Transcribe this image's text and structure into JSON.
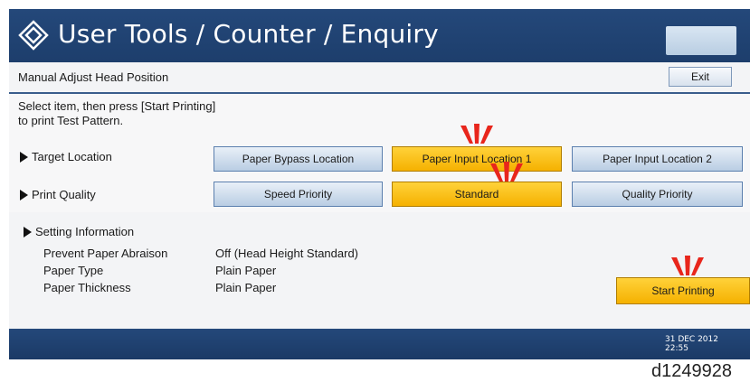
{
  "header": {
    "title": "User Tools / Counter / Enquiry",
    "logo_icon": "diamond-logo-icon"
  },
  "subheader": {
    "title": "Manual Adjust Head Position",
    "exit_label": "Exit"
  },
  "instructions": {
    "line1": "Select item, then press [Start Printing]",
    "line2": "to print Test Pattern."
  },
  "target_location": {
    "label": "Target Location",
    "options": [
      "Paper Bypass Location",
      "Paper Input Location 1",
      "Paper Input Location 2"
    ],
    "selected": "Paper Input Location 1"
  },
  "print_quality": {
    "label": "Print Quality",
    "options": [
      "Speed Priority",
      "Standard",
      "Quality Priority"
    ],
    "selected": "Standard"
  },
  "setting_information": {
    "heading": "Setting Information",
    "rows": [
      {
        "label": "Prevent Paper Abraison",
        "value": "Off (Head Height Standard)"
      },
      {
        "label": "Paper Type",
        "value": "Plain Paper"
      },
      {
        "label": "Paper Thickness",
        "value": "Plain Paper"
      }
    ]
  },
  "start_printing_label": "Start Printing",
  "status": {
    "date": "31 DEC 2012",
    "time": "22:55"
  },
  "figure_code": "d1249928",
  "colors": {
    "header_blue": "#24487a",
    "selected_yellow": "#ffc21a",
    "button_blue": "#b9cde3",
    "highlight_red": "#e8261c"
  }
}
